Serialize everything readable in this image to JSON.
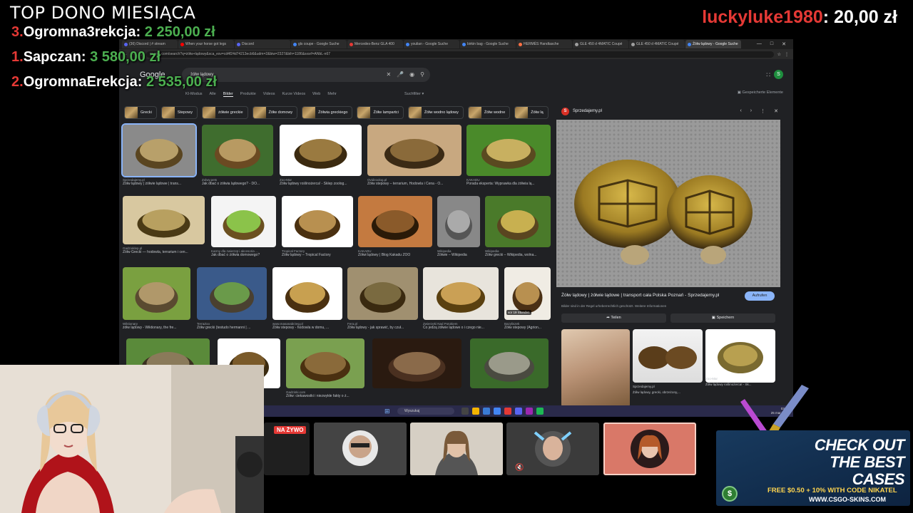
{
  "overlay": {
    "top_donors_title": "TOP DONO MIESIĄCA",
    "donors": [
      {
        "rank": "3.",
        "name": "Ogromna3rekcja:",
        "amount": "2 250,00 zł"
      },
      {
        "rank": "1.",
        "name": "Sapczan:",
        "amount": "3 580,00 zł"
      },
      {
        "rank": "2.",
        "name": "OgromnaErekcja:",
        "amount": "2 535,00 zł"
      }
    ],
    "last_donor": {
      "name": "luckyluke1980",
      "amount": "20,00 zł"
    }
  },
  "browser": {
    "tabs": [
      {
        "label": "(36) Discord | # stream"
      },
      {
        "label": "When your horse got legs"
      },
      {
        "label": "Discord"
      },
      {
        "label": "gls coupe - Google Suche"
      },
      {
        "label": "Mercedes-Benz GLA 400"
      },
      {
        "label": "youlian - Google Suche"
      },
      {
        "label": "birkin bag - Google Suche"
      },
      {
        "label": "HERMÈS Handtasche"
      },
      {
        "label": "GLE 450 d 4MATIC Coupé"
      },
      {
        "label": "GLE 450 d 4MATIC Coupé"
      },
      {
        "label": "Żółw lądowy - Google Suche",
        "active": true
      }
    ],
    "url": "google.com/search?q=żółw+lądowy&sca_esv=cd4f24d74213ecb6&udm=2&biw=2327&bih=1186&sxsrf=ANbL-n67"
  },
  "google": {
    "logo": "Google",
    "query": "żółw lądowy",
    "nav": [
      "KI-Modus",
      "Alle",
      "Bilder",
      "Produkte",
      "Videos",
      "Kurze Videos",
      "Web",
      "Mehr"
    ],
    "nav_active": "Bilder",
    "filter": "Suchfilter",
    "saved": "Gespeicherte Elemente",
    "chips": [
      "Grecki",
      "Stepowy",
      "żółwie greckie",
      "Żółw domowy",
      "Żółwia greckiego",
      "Żółw lampartci",
      "Żółw wodno lądowy",
      "Żółw wodne",
      "Żółw lą"
    ],
    "results": [
      {
        "source": "Sprzedajemy.pl",
        "caption": "Żółw lądowy | żółwie lądowe | trans..."
      },
      {
        "source": "Zolwy.pets",
        "caption": "Jak dbać o żółwia lądowego? - DO..."
      },
      {
        "source": "Zoo-Mar",
        "caption": "Żółw lądowy roślinożerca! - Sklep zoolog..."
      },
      {
        "source": "Ovidzoolog.pl",
        "caption": "Żółw stepowy – terrarium, Hodowla i Cena - O..."
      },
      {
        "source": "KAKADU",
        "caption": "Porada eksperta: Wyprawka dla żółwia lą..."
      },
      {
        "source": "Gadzioklep.pl",
        "caption": "Żółw Grecki — hodowla, terrarium i cen..."
      },
      {
        "source": "Karmy dla zwierząt i akcesoria ...",
        "caption": "Jak dbać o żółwia domowego?"
      },
      {
        "source": "Tropical Factory",
        "caption": "Żółw lądowy – Tropical Factory"
      },
      {
        "source": "KAKADU",
        "caption": "Żółwi lądowy | Blog Kakadu ZOO"
      },
      {
        "source": "Wikipedia",
        "caption": "Żółwie – Wikipedia"
      },
      {
        "source": "Wikipedia",
        "caption": "Żółw grecki – Wikipedia, wolna..."
      },
      {
        "source": "Wiktionary",
        "caption": "żółw lądowy - Wiktionary, the fre..."
      },
      {
        "source": "TerraZoo",
        "caption": "Żółw grecki (testudo hermanni | ..."
      },
      {
        "source": "www.masanabrzeg.pl",
        "caption": "Żółw stepowy - hodowla w domu, ..."
      },
      {
        "source": "Fera.pl",
        "caption": "Żółw lądowy - jak sprawić, by czuł..."
      },
      {
        "source": "Zwierzęki Nad Potokiem",
        "caption": "Co jedzą żółwie lądowe o i czego nie..."
      },
      {
        "source": "Bazyliszek",
        "caption": "Żółw stepowy (Agrion..."
      },
      {
        "source": "Zooporia.pl",
        "caption": "Żółwie lądowe czy wodne? Wybór ideal..."
      },
      {
        "source": "Tapety na Pulpit",
        "caption": "Żółw lądowy"
      },
      {
        "source": "Gadzinki.com",
        "caption": "Żółw: ciekawostki i niezwykłe fakty o ż..."
      }
    ],
    "video_badge": "vor 19 Stunden",
    "preview": {
      "site": "Sprzedajemy.pl",
      "title": "Żółw lądowy | żółwie lądowe | transport cała Polska Poznań - Sprzedajemy.pl",
      "visit": "Aufrufen",
      "note": "Bilder sind in der Regel urheberrechtlich geschützt. Weitere Informationen",
      "share": "Teilen",
      "save": "Speichern",
      "related": [
        {
          "source": "",
          "caption": ""
        },
        {
          "source": "Sprzedajemy.pl",
          "caption": "Żółw lądowy, grecki, obrzeżony,..."
        },
        {
          "source": "Zoo-Mar",
          "caption": "Żółw lądowy roślinożerca! - Sk..."
        }
      ]
    }
  },
  "taskbar": {
    "search": "Wyszukaj",
    "time": "03:14",
    "date": "25 mar 2026"
  },
  "call": {
    "live_badge": "NA ŻYWO"
  },
  "ad": {
    "line1": "CHECK OUT",
    "line2": "THE BEST",
    "line3": "CASES",
    "promo": "FREE $0.50 + 10% WITH CODE NIKATEL",
    "site": "WWW.CSGO-SKINS.COM",
    "coin": "$"
  }
}
